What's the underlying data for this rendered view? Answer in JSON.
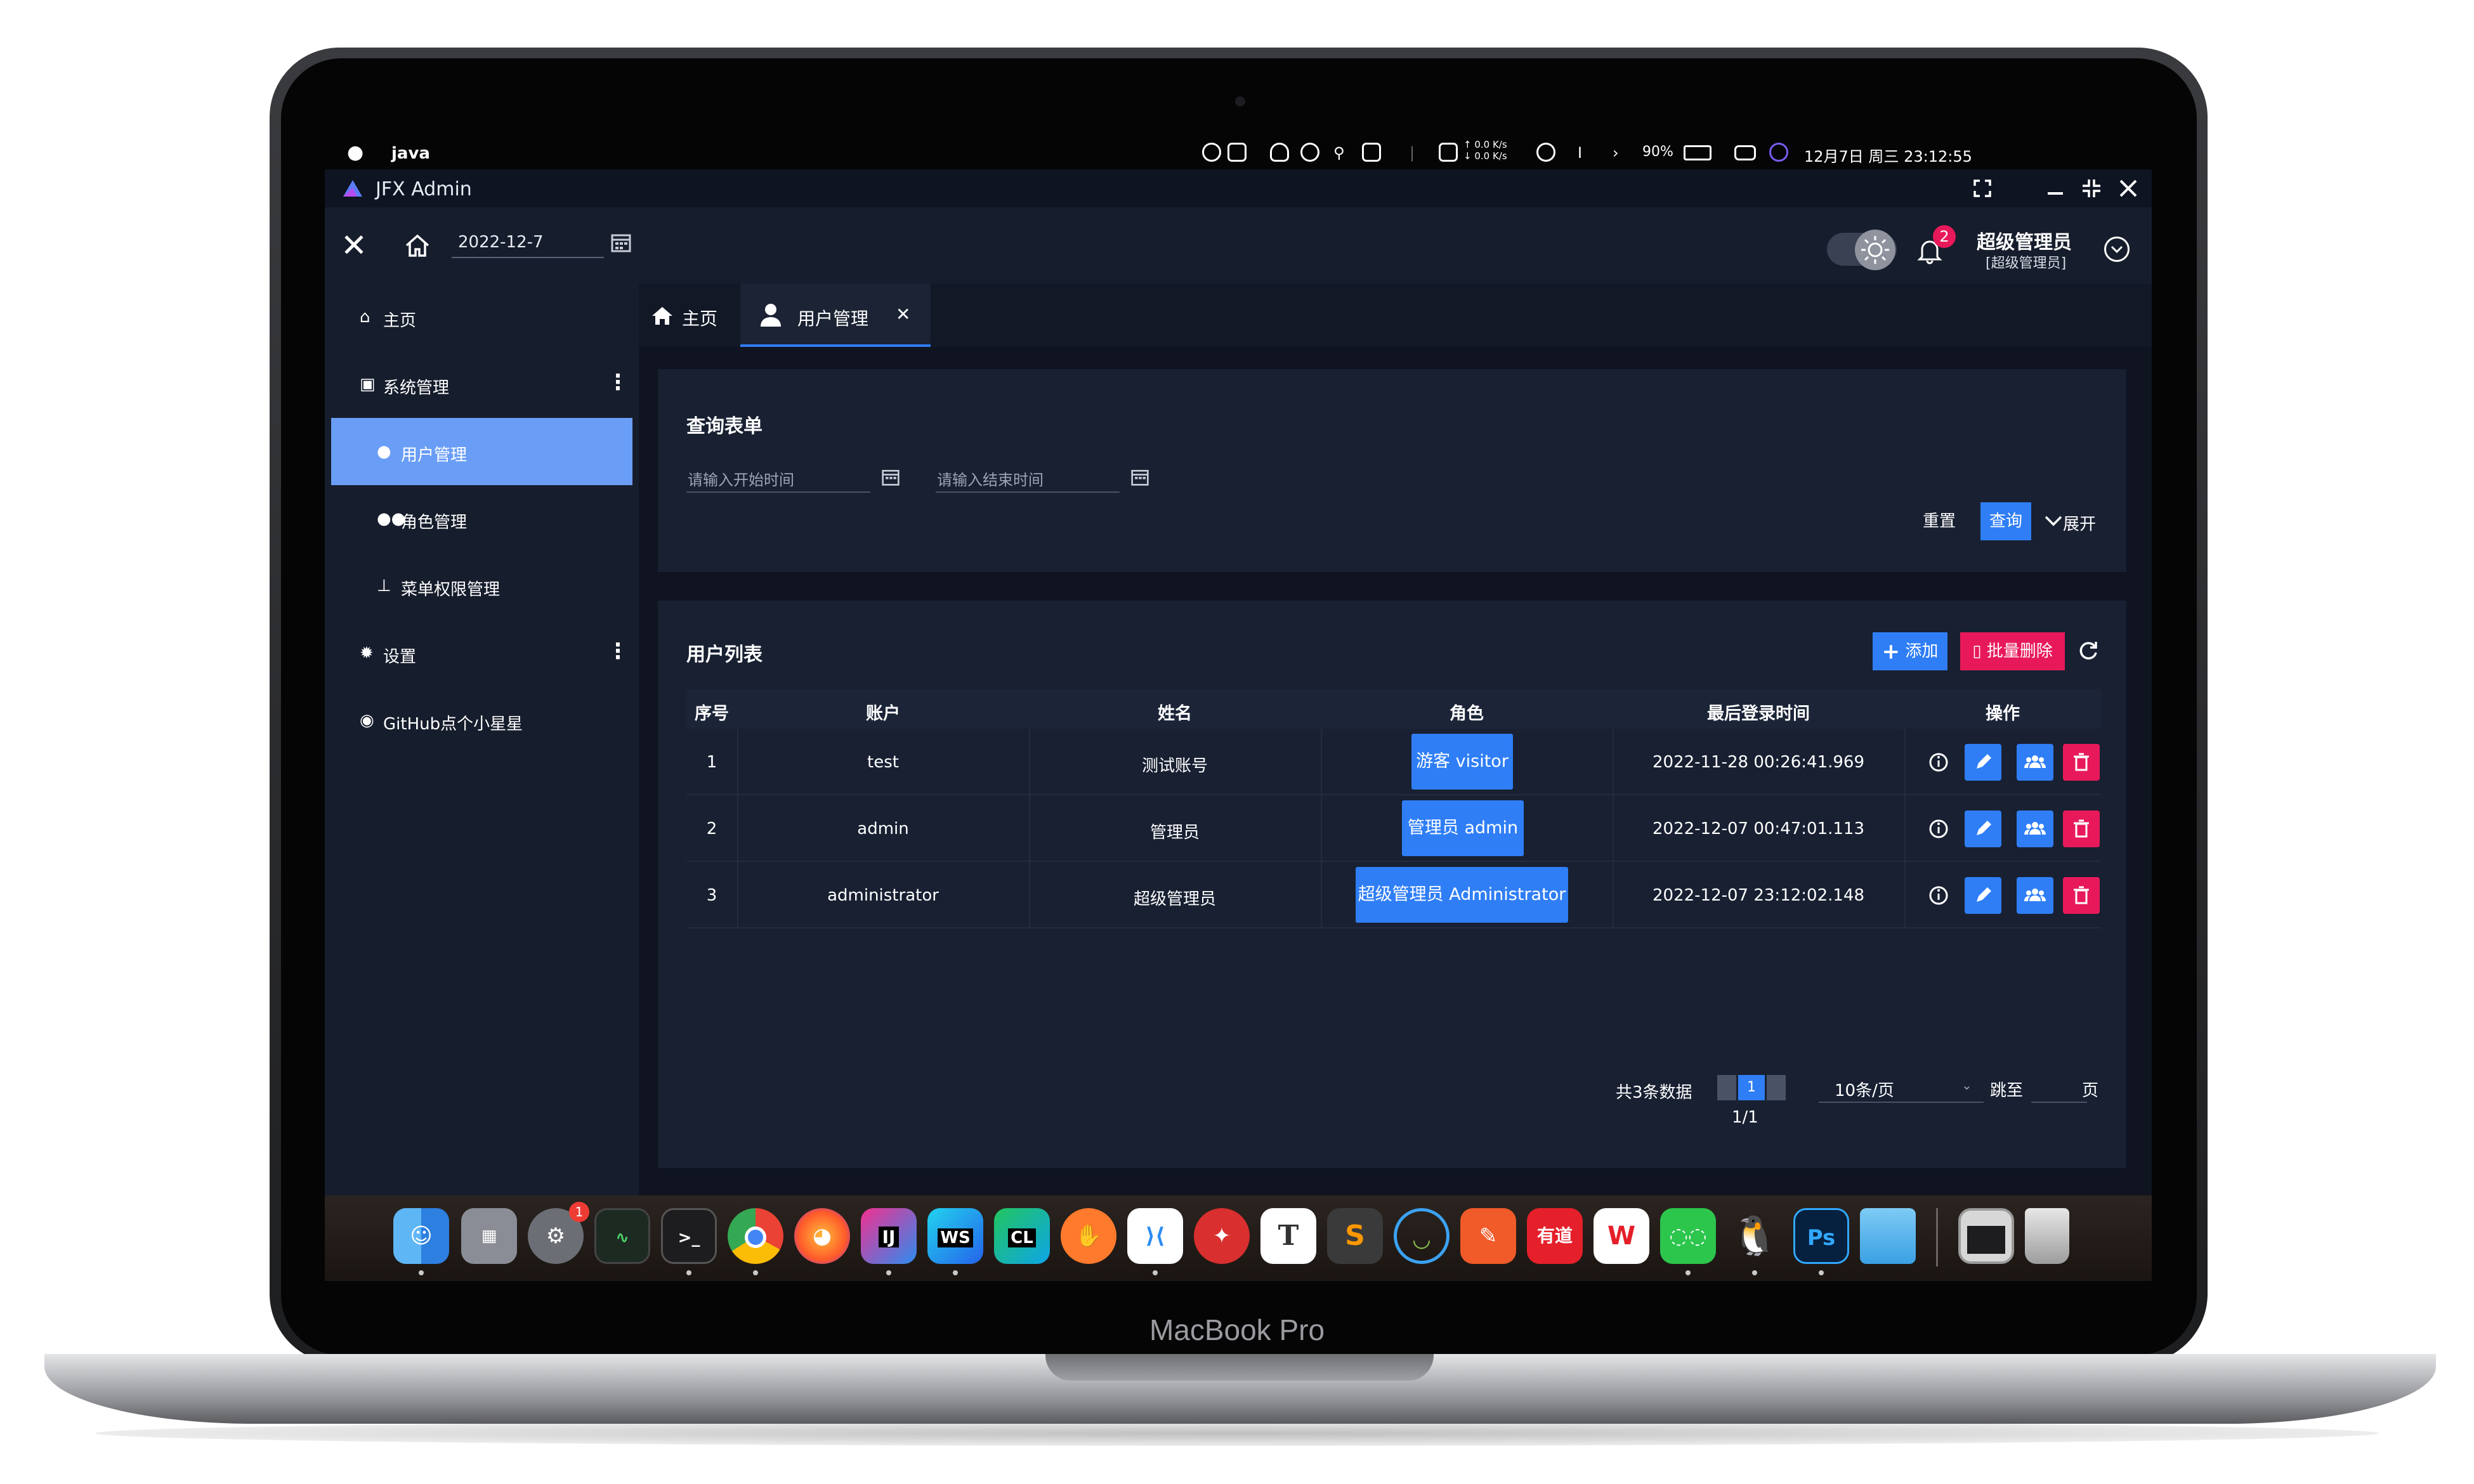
{
  "device": {
    "label": "MacBook Pro"
  },
  "menubar": {
    "app_name": "java",
    "net_up": "↑ 0.0 K/s",
    "net_down": "↓ 0.0 K/s",
    "battery": "90%",
    "datetime": "12月7日 周三  23:12:55"
  },
  "window": {
    "title": "JFX Admin"
  },
  "header": {
    "date_value": "2022-12-7",
    "notification_count": "2",
    "user_name": "超级管理员",
    "user_role": "[超级管理员]"
  },
  "sidebar": {
    "items": [
      {
        "label": "主页"
      },
      {
        "label": "系统管理"
      },
      {
        "label": "用户管理"
      },
      {
        "label": "角色管理"
      },
      {
        "label": "菜单权限管理"
      },
      {
        "label": "设置"
      },
      {
        "label": "GitHub点个小星星"
      }
    ]
  },
  "tabs": [
    {
      "label": "主页"
    },
    {
      "label": "用户管理",
      "close": "✕"
    }
  ],
  "query": {
    "title": "查询表单",
    "start_placeholder": "请输入开始时间",
    "end_placeholder": "请输入结束时间",
    "reset_label": "重置",
    "search_label": "查询",
    "expand_label": "展开"
  },
  "list": {
    "title": "用户列表",
    "add_label": "添加",
    "batch_delete_label": "批量删除",
    "columns": [
      "序号",
      "账户",
      "姓名",
      "角色",
      "最后登录时间",
      "操作"
    ],
    "rows": [
      {
        "no": "1",
        "account": "test",
        "name": "测试账号",
        "role": "游客 visitor",
        "last_login": "2022-11-28 00:26:41.969"
      },
      {
        "no": "2",
        "account": "admin",
        "name": "管理员",
        "role": "管理员 admin",
        "last_login": "2022-12-07 00:47:01.113"
      },
      {
        "no": "3",
        "account": "administrator",
        "name": "超级管理员",
        "role": "超级管理员 Administrator",
        "last_login": "2022-12-07 23:12:02.148"
      }
    ]
  },
  "pager": {
    "total": "共3条数据",
    "current_page": "1",
    "page_info": "1/1",
    "page_size": "10条/页",
    "jump_label": "跳至",
    "page_suffix": "页"
  },
  "dock": {
    "settings_badge": "1",
    "apps": [
      "Finder",
      "Launchpad",
      "System Preferences",
      "Activity Monitor",
      "Terminal",
      "Chrome",
      "Firefox",
      "IntelliJ IDEA",
      "WebStorm",
      "CLion",
      "Postman",
      "VS Code",
      "Typora",
      "Typora T",
      "Sublime Text",
      "Navicat",
      "Pen",
      "Youdao",
      "WPS",
      "WeChat",
      "QQ",
      "Photoshop",
      "Folder",
      "Screen",
      "Trash"
    ]
  },
  "colors": {
    "accent": "#2f7ef6",
    "danger": "#e8195a",
    "sidebar_active": "#6a9ef6",
    "background": "#141a27"
  }
}
